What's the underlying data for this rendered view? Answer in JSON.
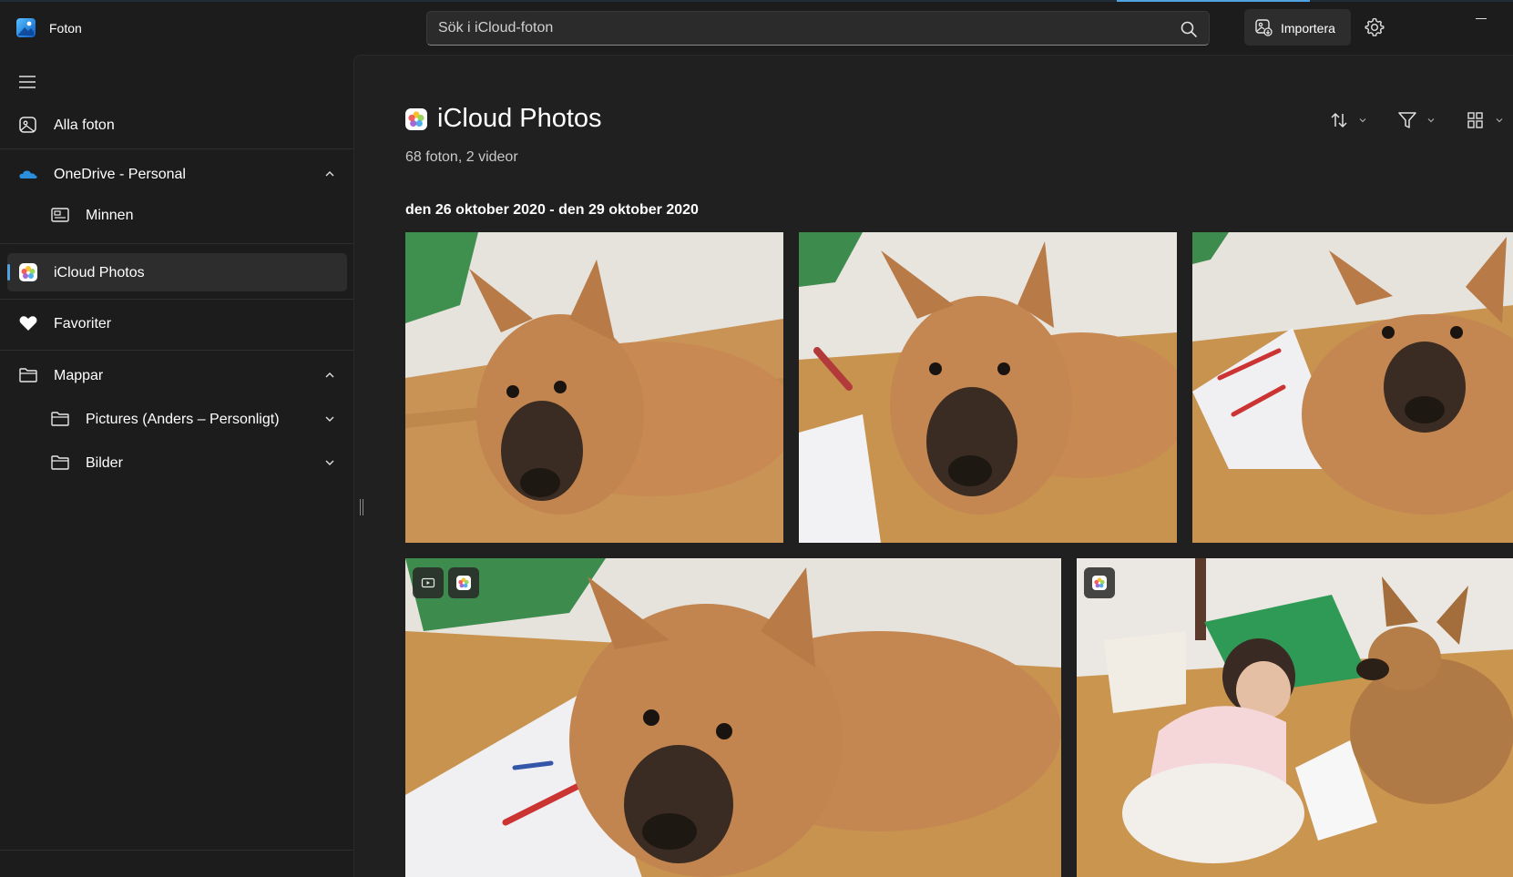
{
  "app": {
    "title": "Foton"
  },
  "search": {
    "placeholder": "Sök i iCloud-foton",
    "value": ""
  },
  "toolbar": {
    "import_label": "Importera"
  },
  "sidebar": {
    "items": [
      {
        "label": "Alla foton"
      },
      {
        "label": "OneDrive - Personal"
      },
      {
        "label": "Minnen"
      },
      {
        "label": "iCloud Photos"
      },
      {
        "label": "Favoriter"
      },
      {
        "label": "Mappar"
      },
      {
        "label": "Pictures (Anders – Personligt)"
      },
      {
        "label": "Bilder"
      }
    ],
    "active_item": "iCloud Photos"
  },
  "main": {
    "title": "iCloud Photos",
    "subtitle": "68 foton, 2 videor",
    "groups": [
      {
        "date_range": "den 26 oktober 2020 - den 29 oktober 2020"
      }
    ],
    "photos": [
      {
        "subject": "dog lying on wooden floor",
        "badges": []
      },
      {
        "subject": "dog with child drawing",
        "badges": []
      },
      {
        "subject": "dog next to crayons",
        "badges": []
      },
      {
        "subject": "dog close-up on floor",
        "badges": [
          "video-icon",
          "icloud-photos-icon"
        ]
      },
      {
        "subject": "child and dog drawing",
        "badges": [
          "icloud-photos-icon"
        ]
      }
    ]
  },
  "colors": {
    "accent": "#4fa3e0",
    "background": "#1c1c1c",
    "content_background": "#202020",
    "selected_item": "#2d2d2d"
  }
}
